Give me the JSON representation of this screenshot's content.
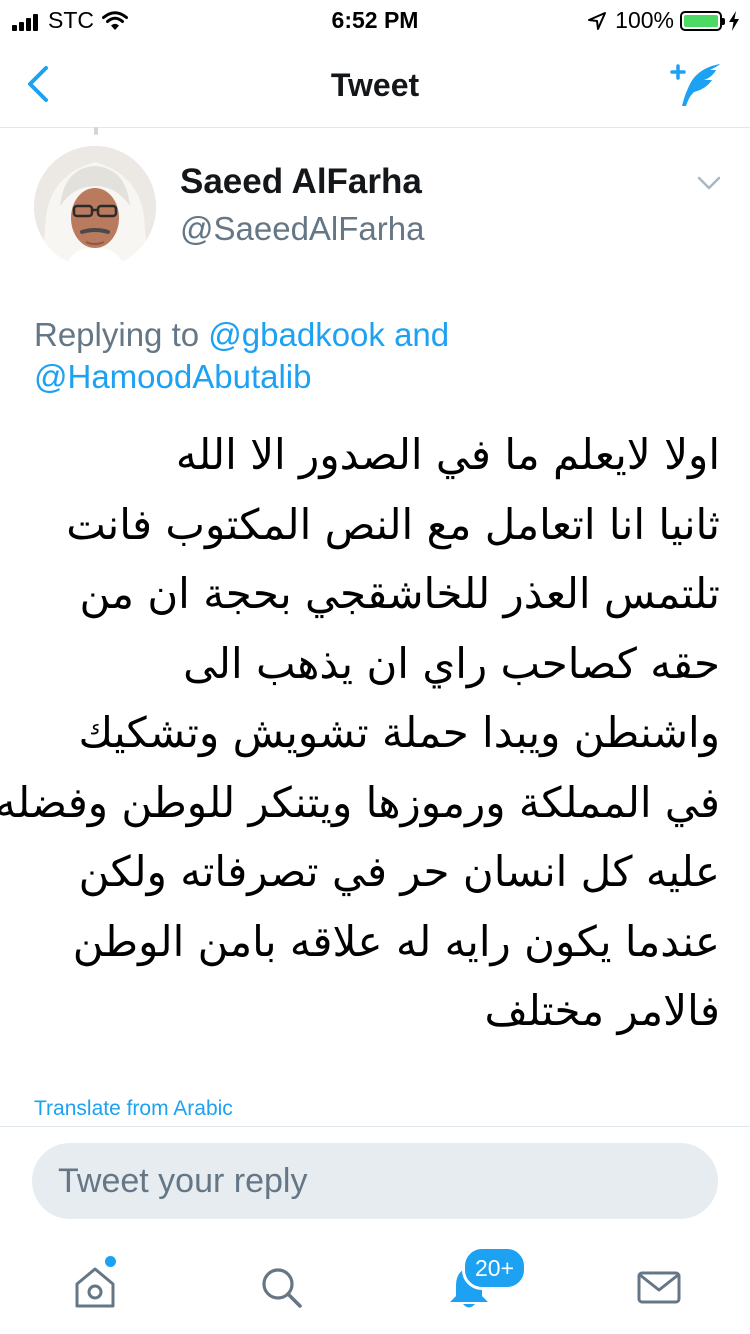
{
  "status_bar": {
    "carrier": "STC",
    "time": "6:52 PM",
    "battery": "100%"
  },
  "nav": {
    "title": "Tweet"
  },
  "tweet": {
    "author_name": "Saeed AlFarha",
    "author_handle": "@SaeedAlFarha",
    "replying_prefix": "Replying to",
    "replying_to_1": "@gbadkook",
    "replying_join": "and",
    "replying_to_2": "@HamoodAbutalib",
    "body_lines": [
      "اولا لايعلم ما في الصدور الا الله",
      "ثانيا انا اتعامل مع النص المكتوب فانت",
      "تلتمس العذر للخاشقجي بحجة ان من",
      "حقه كصاحب راي ان يذهب الى",
      "واشنطن ويبدا حملة تشويش وتشكيك",
      "في المملكة ورموزها ويتنكر للوطن وفضله",
      "عليه كل انسان حر في تصرفاته ولكن",
      "عندما يكون رايه له علاقه بامن الوطن",
      "فالامر مختلف"
    ],
    "translate_label": "Translate from Arabic"
  },
  "reply": {
    "placeholder": "Tweet your reply"
  },
  "tabs": {
    "notifications_badge": "20+"
  },
  "colors": {
    "accent": "#1da1f2",
    "secondary_text": "#657786",
    "input_bg": "#e6ecf0",
    "battery": "#4cd964"
  },
  "icons": [
    "back-chevron-icon",
    "compose-tweet-icon",
    "chevron-down-icon",
    "home-icon",
    "search-icon",
    "notifications-bell-icon",
    "messages-envelope-icon",
    "wifi-icon",
    "location-arrow-icon",
    "charging-bolt-icon"
  ]
}
